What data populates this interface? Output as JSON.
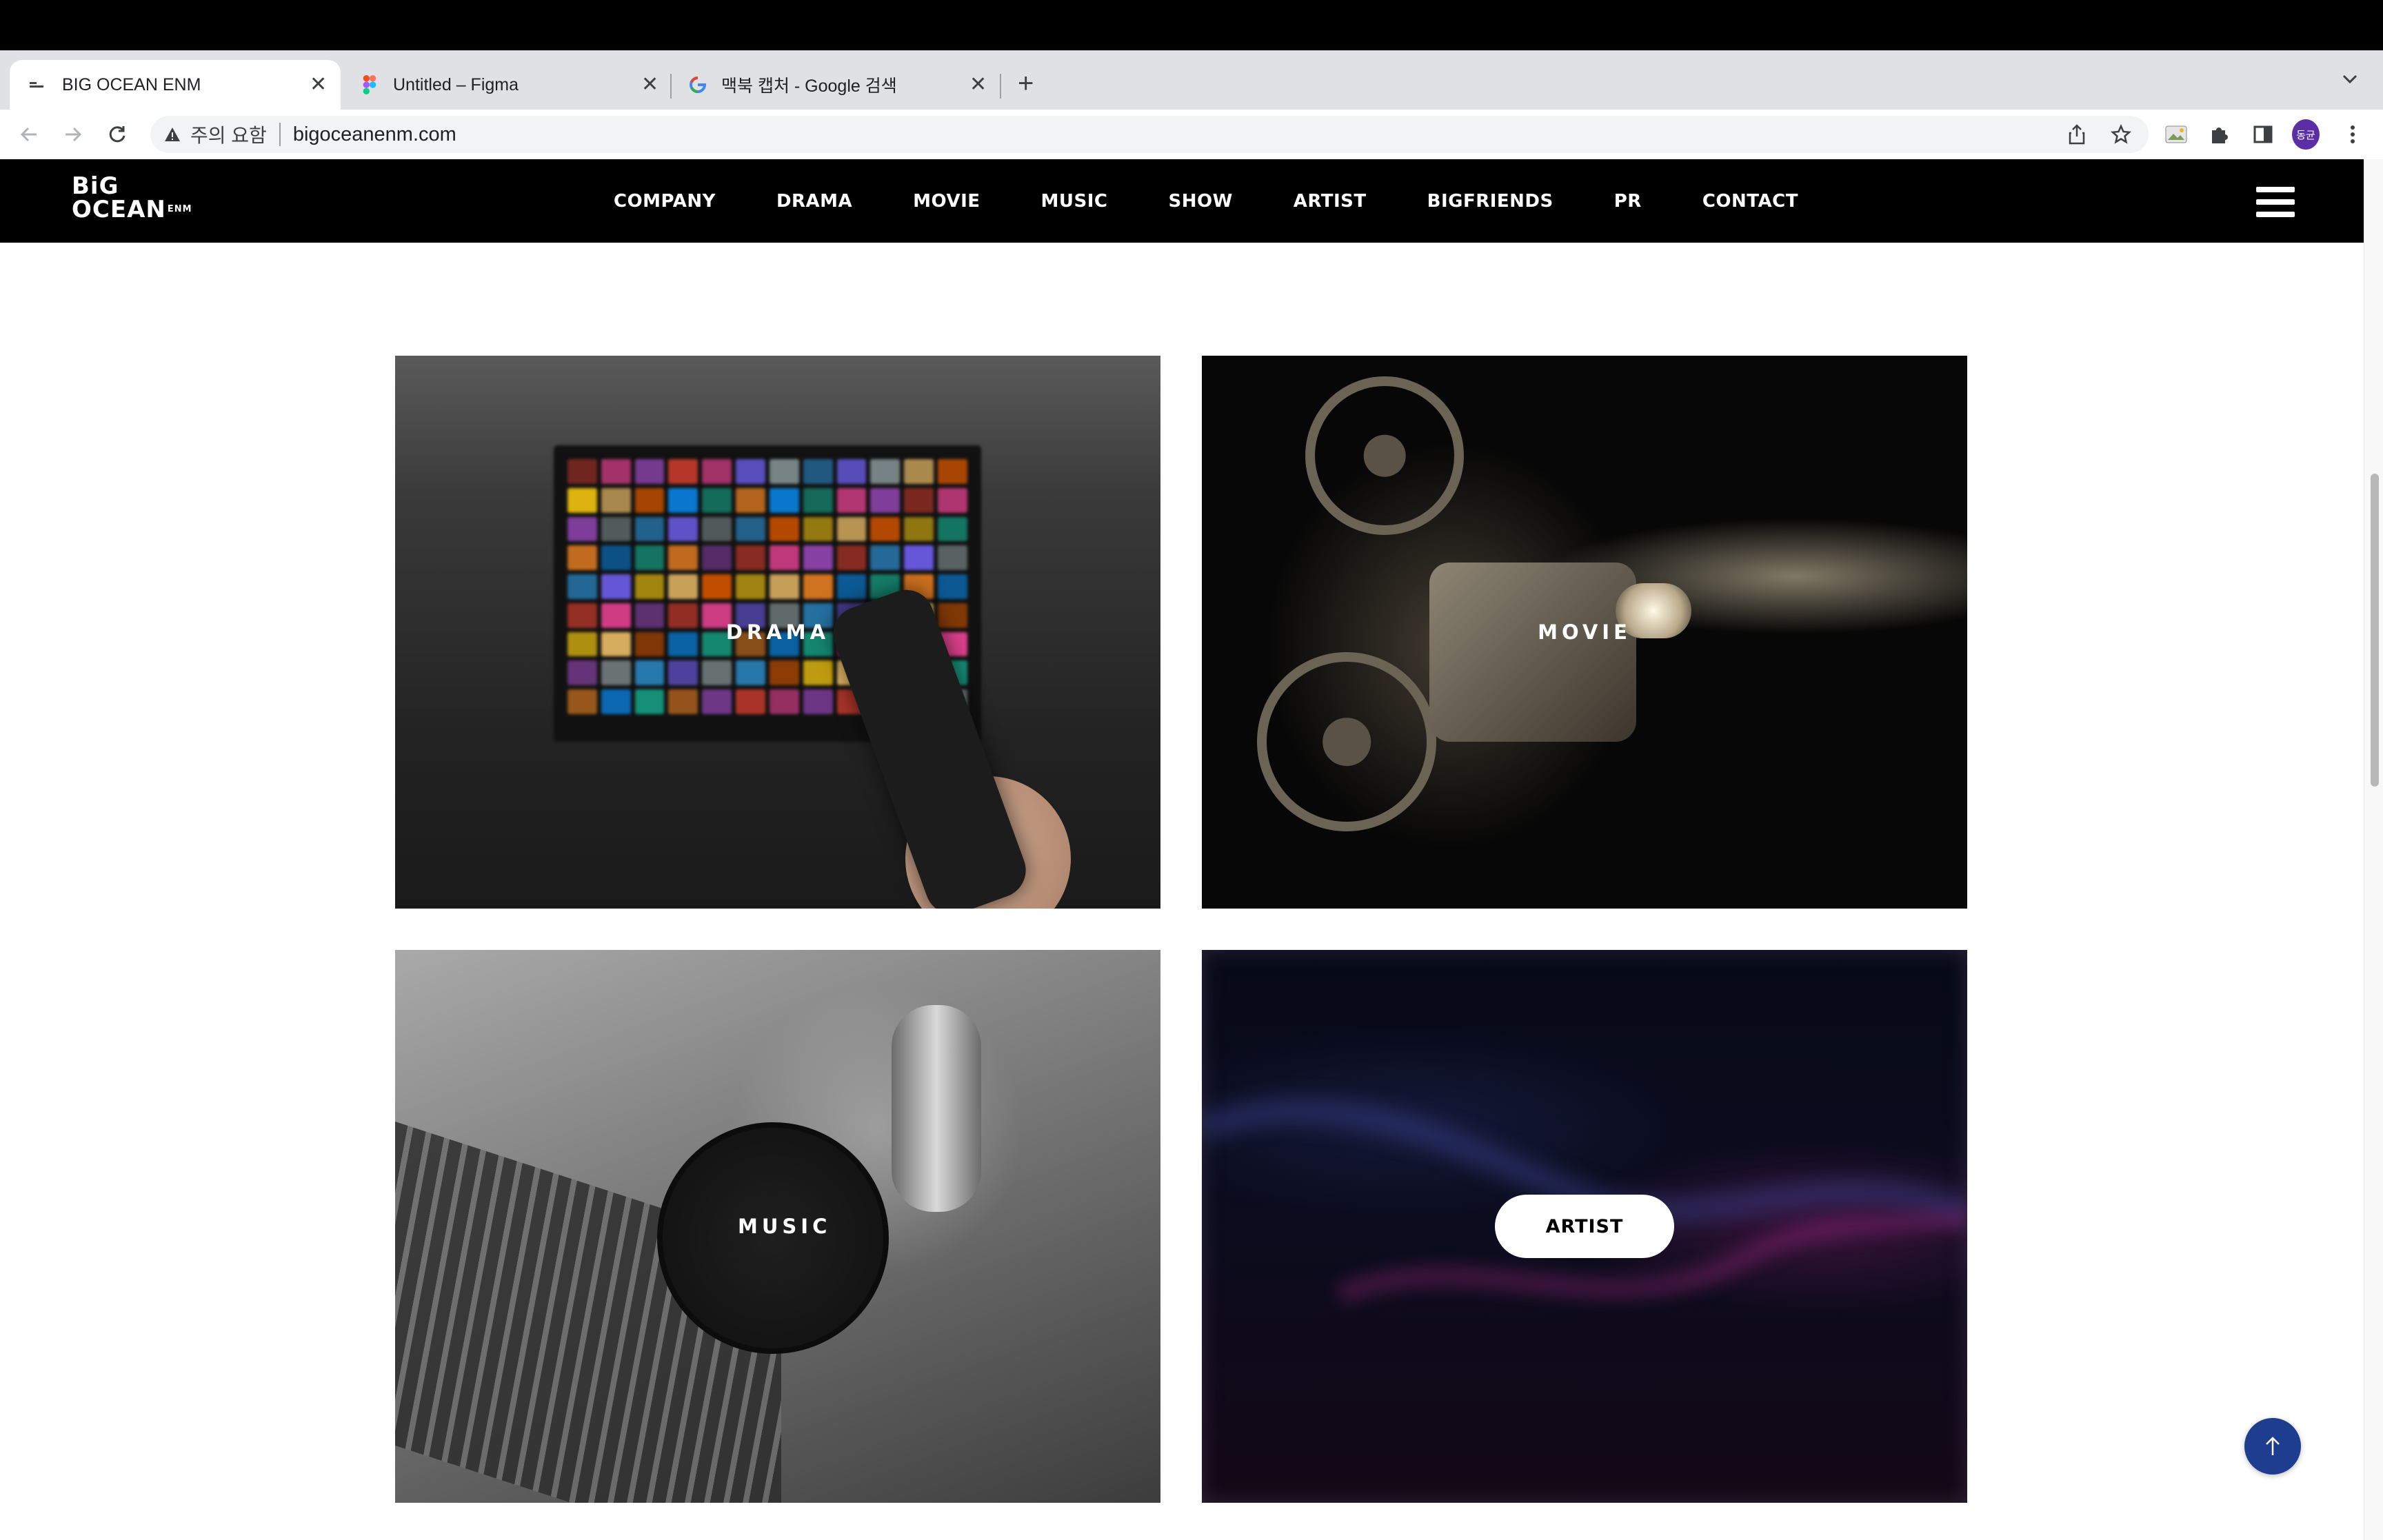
{
  "browser": {
    "tabs": [
      {
        "title": "BIG OCEAN ENM",
        "active": true
      },
      {
        "title": "Untitled – Figma",
        "active": false
      },
      {
        "title": "맥북 캡처 - Google 검색",
        "active": false
      }
    ],
    "address": {
      "warning": "주의 요함",
      "url": "bigoceanenm.com"
    },
    "profile_initials": "동균"
  },
  "site": {
    "logo_line1": "BiG",
    "logo_line2": "OCEAN",
    "logo_suffix": "ENM",
    "nav": [
      "COMPANY",
      "DRAMA",
      "MOVIE",
      "MUSIC",
      "SHOW",
      "ARTIST",
      "BIGFRIENDS",
      "PR",
      "CONTACT"
    ]
  },
  "cards": {
    "drama": "DRAMA",
    "movie": "MOVIE",
    "music": "MUSIC",
    "artist": "ARTIST"
  },
  "colors": {
    "header_bg": "#000000",
    "top_button": "#1e3d8f",
    "profile": "#5b2ea6"
  }
}
